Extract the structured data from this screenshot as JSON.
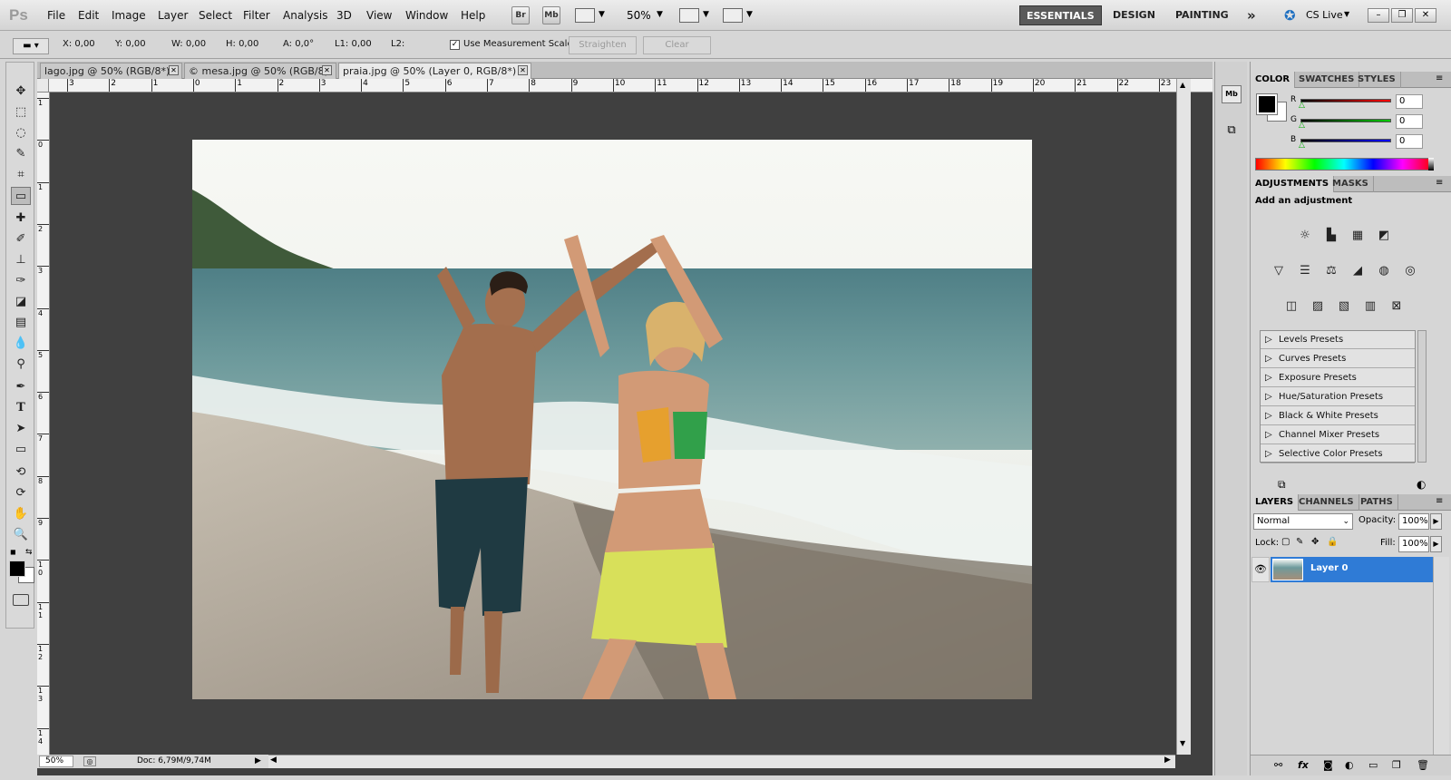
{
  "app": {
    "logo": "Ps"
  },
  "menu": [
    "File",
    "Edit",
    "Image",
    "Layer",
    "Select",
    "Filter",
    "Analysis",
    "3D",
    "View",
    "Window",
    "Help"
  ],
  "menubar": {
    "bridge_label": "Br",
    "minibridge_label": "Mb",
    "zoom_value": "50%",
    "workspaces": [
      "ESSENTIALS",
      "DESIGN",
      "PAINTING"
    ],
    "more": "»",
    "cs_live": "CS Live"
  },
  "options": {
    "x": "X: 0,00",
    "y": "Y: 0,00",
    "w": "W: 0,00",
    "h": "H: 0,00",
    "a": "A: 0,0°",
    "l1": "L1: 0,00",
    "l2": "L2:",
    "use_measurement_scale": "Use Measurement Scale",
    "straighten": "Straighten",
    "clear": "Clear"
  },
  "tabs": [
    {
      "label": "lago.jpg @ 50% (RGB/8*)"
    },
    {
      "label": "© mesa.jpg @ 50% (RGB/8)"
    },
    {
      "label": "praia.jpg @ 50% (Layer 0, RGB/8*) *"
    }
  ],
  "hruler_ticks": [
    "3",
    "2",
    "1",
    "0",
    "1",
    "2",
    "3",
    "4",
    "5",
    "6",
    "7",
    "8",
    "9",
    "10",
    "11",
    "12",
    "13",
    "14",
    "15",
    "16",
    "17",
    "18",
    "19",
    "20",
    "21",
    "22",
    "23"
  ],
  "vruler_ticks": [
    "1",
    "0",
    "1",
    "2",
    "3",
    "4",
    "5",
    "6",
    "7",
    "8",
    "9",
    "1\n0",
    "1\n1",
    "1\n2",
    "1\n3",
    "1\n4"
  ],
  "status": {
    "zoom": "50%",
    "doc": "Doc: 6,79M/9,74M"
  },
  "color_panel": {
    "tabs": [
      "COLOR",
      "SWATCHES",
      "STYLES"
    ],
    "r_label": "R",
    "g_label": "G",
    "b_label": "B",
    "r": "0",
    "g": "0",
    "b": "0"
  },
  "adjustments": {
    "tabs": [
      "ADJUSTMENTS",
      "MASKS"
    ],
    "title": "Add an adjustment",
    "presets": [
      "Levels Presets",
      "Curves Presets",
      "Exposure Presets",
      "Hue/Saturation Presets",
      "Black & White Presets",
      "Channel Mixer Presets",
      "Selective Color Presets"
    ]
  },
  "layers": {
    "tabs": [
      "LAYERS",
      "CHANNELS",
      "PATHS"
    ],
    "blend_mode": "Normal",
    "opacity_label": "Opacity:",
    "opacity": "100%",
    "lock_label": "Lock:",
    "fill_label": "Fill:",
    "fill": "100%",
    "layer_name": "Layer 0"
  },
  "colors": {
    "selection": "#2f7bd6",
    "canvas_bg": "#404040"
  }
}
